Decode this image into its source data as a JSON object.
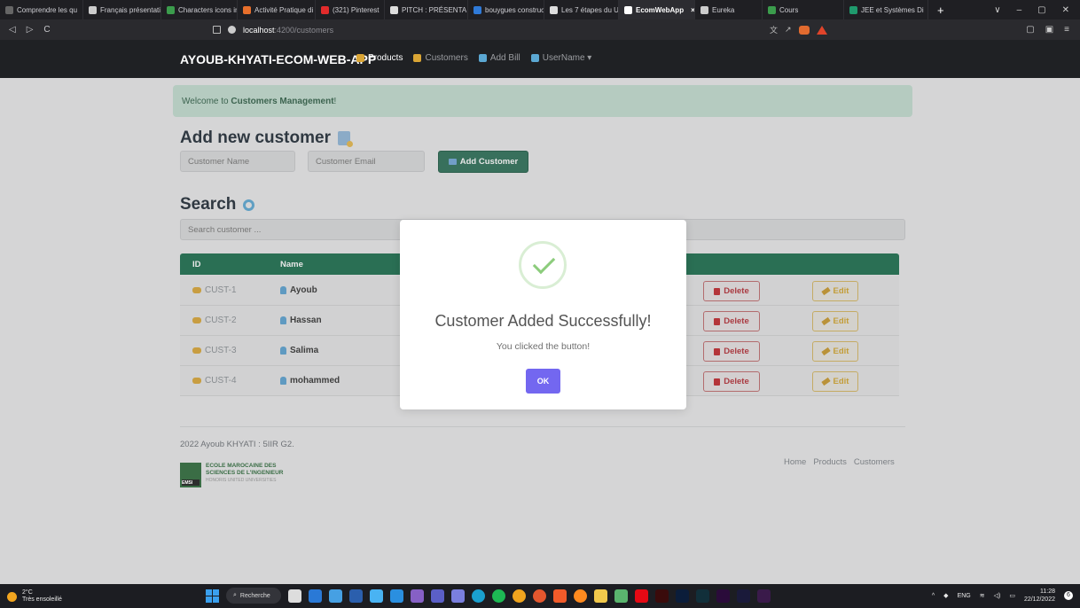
{
  "browser": {
    "tabs": [
      {
        "label": "Comprendre les qu",
        "color": "#666"
      },
      {
        "label": "Français présentati",
        "color": "#ccc"
      },
      {
        "label": "Characters icons in",
        "color": "#3b9c4c"
      },
      {
        "label": "Activité Pratique di",
        "color": "#e76f2b"
      },
      {
        "label": "(321) Pinterest",
        "color": "#e22b2b"
      },
      {
        "label": "PITCH : PRÉSENTA",
        "color": "#ddd"
      },
      {
        "label": "bouygues construc",
        "color": "#2f7ad8"
      },
      {
        "label": "Les 7 étapes du UX",
        "color": "#ddd"
      },
      {
        "label": "EcomWebApp",
        "color": "#ffffff"
      },
      {
        "label": "Eureka",
        "color": "#ccc"
      },
      {
        "label": "Cours",
        "color": "#3b9c4c"
      },
      {
        "label": "JEE et Systèmes Di",
        "color": "#1f9a6d"
      }
    ],
    "active_tab_index": 8,
    "url_host": "localhost",
    "url_path": ":4200/customers"
  },
  "navbar": {
    "brand": "AYOUB-KHYATI-ECOM-WEB-APP",
    "links": [
      {
        "label": "Products",
        "icon": "box-icon",
        "color": "#d9a535",
        "active": true
      },
      {
        "label": "Customers",
        "icon": "customers-icon",
        "color": "#d9a535",
        "active": false
      },
      {
        "label": "Add Bill",
        "icon": "document-icon",
        "color": "#5ba8d3",
        "active": false
      },
      {
        "label": "UserName ▾",
        "icon": "user-icon",
        "color": "#5ba8d3",
        "active": false
      }
    ]
  },
  "alert": {
    "prefix": "Welcome to ",
    "strong": "Customers Management",
    "suffix": "!"
  },
  "add_section": {
    "title": "Add new customer",
    "name_placeholder": "Customer Name",
    "email_placeholder": "Customer Email",
    "button": "Add Customer"
  },
  "search_section": {
    "title": "Search",
    "placeholder": "Search customer ..."
  },
  "table": {
    "headers": {
      "id": "ID",
      "name": "Name"
    },
    "rows": [
      {
        "id": "CUST-1",
        "name": "Ayoub"
      },
      {
        "id": "CUST-2",
        "name": "Hassan"
      },
      {
        "id": "CUST-3",
        "name": "Salima"
      },
      {
        "id": "CUST-4",
        "name": "mohammed"
      }
    ],
    "delete_label": "Delete",
    "edit_label": "Edit"
  },
  "footer": {
    "copyright": "2022 Ayoub KHYATI : 5IIR G2.",
    "logo_line1": "ECOLE MAROCAINE DES",
    "logo_line2": "SCIENCES DE L'INGENIEUR",
    "logo_sub": "HONORIS UNITED UNIVERSITIES",
    "logo_badge": "EMSI",
    "links": [
      "Home",
      "Products",
      "Customers"
    ]
  },
  "modal": {
    "title": "Customer Added Successfully!",
    "text": "You clicked the button!",
    "ok": "OK"
  },
  "taskbar": {
    "temperature": "2°C",
    "weather": "Très ensoleillé",
    "search": "Recherche",
    "lang": "ENG",
    "time": "11:28",
    "date": "22/12/2022",
    "notification_count": "6"
  }
}
